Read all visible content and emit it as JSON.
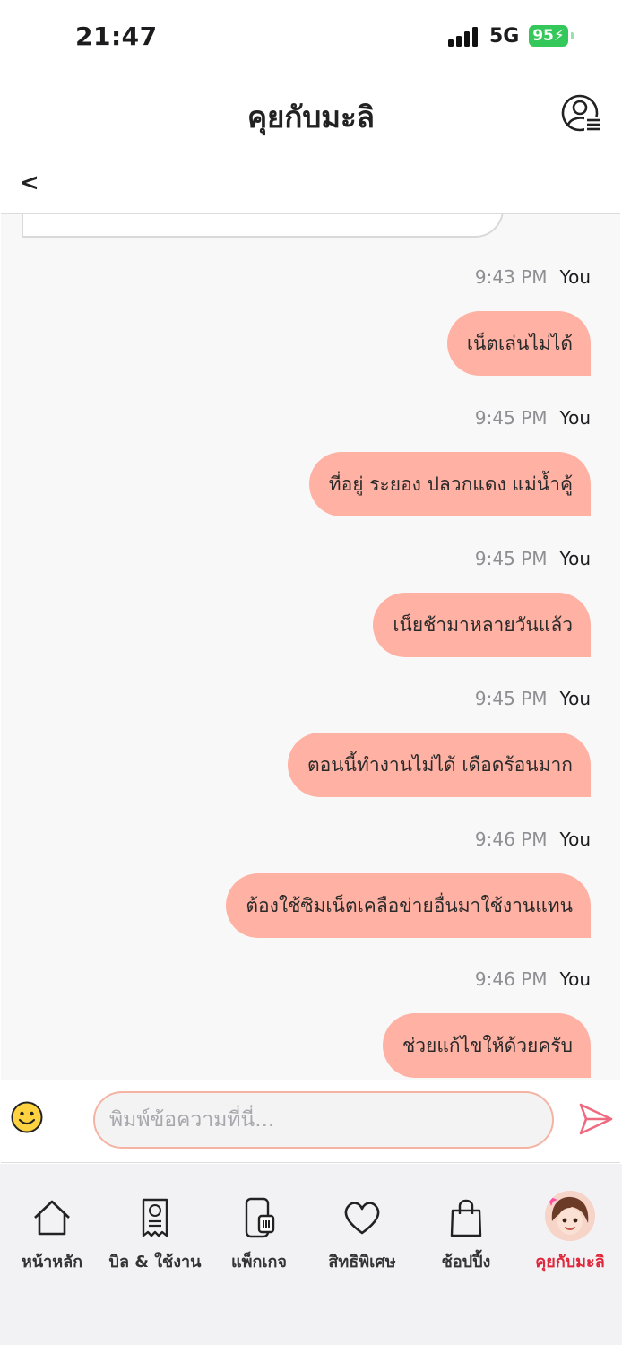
{
  "status": {
    "time": "21:47",
    "network": "5G",
    "battery": "95"
  },
  "header": {
    "title": "คุยกับมะลิ",
    "back_label": "<"
  },
  "messages": [
    {
      "time": "9:43 PM",
      "sender": "You",
      "text": "เน็ตเล่นไม่ได้"
    },
    {
      "time": "9:45 PM",
      "sender": "You",
      "text": "ที่อยู่ ระยอง ปลวกแดง แม่น้ำคู้"
    },
    {
      "time": "9:45 PM",
      "sender": "You",
      "text": "เน็ยช้ามาหลายวันแล้ว"
    },
    {
      "time": "9:45 PM",
      "sender": "You",
      "text": "ตอนนี้ทำงานไม่ได้ เดือดร้อนมาก"
    },
    {
      "time": "9:46 PM",
      "sender": "You",
      "text": "ต้องใช้ซิมเน็ตเคลือข่ายอื่นมาใช้งานแทน"
    },
    {
      "time": "9:46 PM",
      "sender": "You",
      "text": "ช่วยแก้ไขให้ด้วยครับ"
    }
  ],
  "input": {
    "placeholder": "พิมพ์ข้อความที่นี่...",
    "value": ""
  },
  "nav": {
    "items": [
      {
        "label": "หน้าหลัก",
        "icon": "home-icon"
      },
      {
        "label": "บิล & ใช้งาน",
        "icon": "bill-receipt-icon"
      },
      {
        "label": "แพ็กเกจ",
        "icon": "sim-package-icon"
      },
      {
        "label": "สิทธิพิเศษ",
        "icon": "heart-icon"
      },
      {
        "label": "ช้อปปิ้ง",
        "icon": "shopping-bag-icon"
      },
      {
        "label": "คุยกับมะลิ",
        "icon": "mali-avatar"
      }
    ],
    "active_index": 5
  },
  "colors": {
    "accent": "#e0263b",
    "bubble": "#ffb1a3",
    "send": "#f06a7f",
    "battery": "#34c759"
  }
}
